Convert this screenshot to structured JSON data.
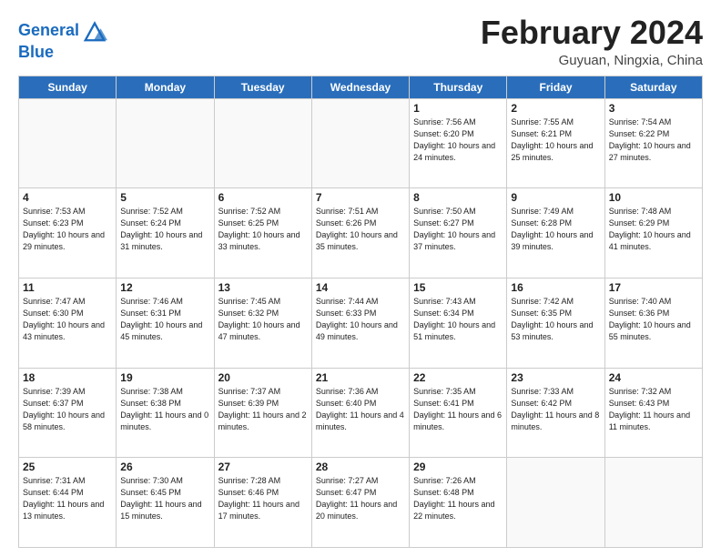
{
  "logo": {
    "line1": "General",
    "line2": "Blue"
  },
  "title": "February 2024",
  "location": "Guyuan, Ningxia, China",
  "days_header": [
    "Sunday",
    "Monday",
    "Tuesday",
    "Wednesday",
    "Thursday",
    "Friday",
    "Saturday"
  ],
  "weeks": [
    [
      {
        "day": "",
        "info": ""
      },
      {
        "day": "",
        "info": ""
      },
      {
        "day": "",
        "info": ""
      },
      {
        "day": "",
        "info": ""
      },
      {
        "day": "1",
        "info": "Sunrise: 7:56 AM\nSunset: 6:20 PM\nDaylight: 10 hours\nand 24 minutes."
      },
      {
        "day": "2",
        "info": "Sunrise: 7:55 AM\nSunset: 6:21 PM\nDaylight: 10 hours\nand 25 minutes."
      },
      {
        "day": "3",
        "info": "Sunrise: 7:54 AM\nSunset: 6:22 PM\nDaylight: 10 hours\nand 27 minutes."
      }
    ],
    [
      {
        "day": "4",
        "info": "Sunrise: 7:53 AM\nSunset: 6:23 PM\nDaylight: 10 hours\nand 29 minutes."
      },
      {
        "day": "5",
        "info": "Sunrise: 7:52 AM\nSunset: 6:24 PM\nDaylight: 10 hours\nand 31 minutes."
      },
      {
        "day": "6",
        "info": "Sunrise: 7:52 AM\nSunset: 6:25 PM\nDaylight: 10 hours\nand 33 minutes."
      },
      {
        "day": "7",
        "info": "Sunrise: 7:51 AM\nSunset: 6:26 PM\nDaylight: 10 hours\nand 35 minutes."
      },
      {
        "day": "8",
        "info": "Sunrise: 7:50 AM\nSunset: 6:27 PM\nDaylight: 10 hours\nand 37 minutes."
      },
      {
        "day": "9",
        "info": "Sunrise: 7:49 AM\nSunset: 6:28 PM\nDaylight: 10 hours\nand 39 minutes."
      },
      {
        "day": "10",
        "info": "Sunrise: 7:48 AM\nSunset: 6:29 PM\nDaylight: 10 hours\nand 41 minutes."
      }
    ],
    [
      {
        "day": "11",
        "info": "Sunrise: 7:47 AM\nSunset: 6:30 PM\nDaylight: 10 hours\nand 43 minutes."
      },
      {
        "day": "12",
        "info": "Sunrise: 7:46 AM\nSunset: 6:31 PM\nDaylight: 10 hours\nand 45 minutes."
      },
      {
        "day": "13",
        "info": "Sunrise: 7:45 AM\nSunset: 6:32 PM\nDaylight: 10 hours\nand 47 minutes."
      },
      {
        "day": "14",
        "info": "Sunrise: 7:44 AM\nSunset: 6:33 PM\nDaylight: 10 hours\nand 49 minutes."
      },
      {
        "day": "15",
        "info": "Sunrise: 7:43 AM\nSunset: 6:34 PM\nDaylight: 10 hours\nand 51 minutes."
      },
      {
        "day": "16",
        "info": "Sunrise: 7:42 AM\nSunset: 6:35 PM\nDaylight: 10 hours\nand 53 minutes."
      },
      {
        "day": "17",
        "info": "Sunrise: 7:40 AM\nSunset: 6:36 PM\nDaylight: 10 hours\nand 55 minutes."
      }
    ],
    [
      {
        "day": "18",
        "info": "Sunrise: 7:39 AM\nSunset: 6:37 PM\nDaylight: 10 hours\nand 58 minutes."
      },
      {
        "day": "19",
        "info": "Sunrise: 7:38 AM\nSunset: 6:38 PM\nDaylight: 11 hours\nand 0 minutes."
      },
      {
        "day": "20",
        "info": "Sunrise: 7:37 AM\nSunset: 6:39 PM\nDaylight: 11 hours\nand 2 minutes."
      },
      {
        "day": "21",
        "info": "Sunrise: 7:36 AM\nSunset: 6:40 PM\nDaylight: 11 hours\nand 4 minutes."
      },
      {
        "day": "22",
        "info": "Sunrise: 7:35 AM\nSunset: 6:41 PM\nDaylight: 11 hours\nand 6 minutes."
      },
      {
        "day": "23",
        "info": "Sunrise: 7:33 AM\nSunset: 6:42 PM\nDaylight: 11 hours\nand 8 minutes."
      },
      {
        "day": "24",
        "info": "Sunrise: 7:32 AM\nSunset: 6:43 PM\nDaylight: 11 hours\nand 11 minutes."
      }
    ],
    [
      {
        "day": "25",
        "info": "Sunrise: 7:31 AM\nSunset: 6:44 PM\nDaylight: 11 hours\nand 13 minutes."
      },
      {
        "day": "26",
        "info": "Sunrise: 7:30 AM\nSunset: 6:45 PM\nDaylight: 11 hours\nand 15 minutes."
      },
      {
        "day": "27",
        "info": "Sunrise: 7:28 AM\nSunset: 6:46 PM\nDaylight: 11 hours\nand 17 minutes."
      },
      {
        "day": "28",
        "info": "Sunrise: 7:27 AM\nSunset: 6:47 PM\nDaylight: 11 hours\nand 20 minutes."
      },
      {
        "day": "29",
        "info": "Sunrise: 7:26 AM\nSunset: 6:48 PM\nDaylight: 11 hours\nand 22 minutes."
      },
      {
        "day": "",
        "info": ""
      },
      {
        "day": "",
        "info": ""
      }
    ]
  ]
}
